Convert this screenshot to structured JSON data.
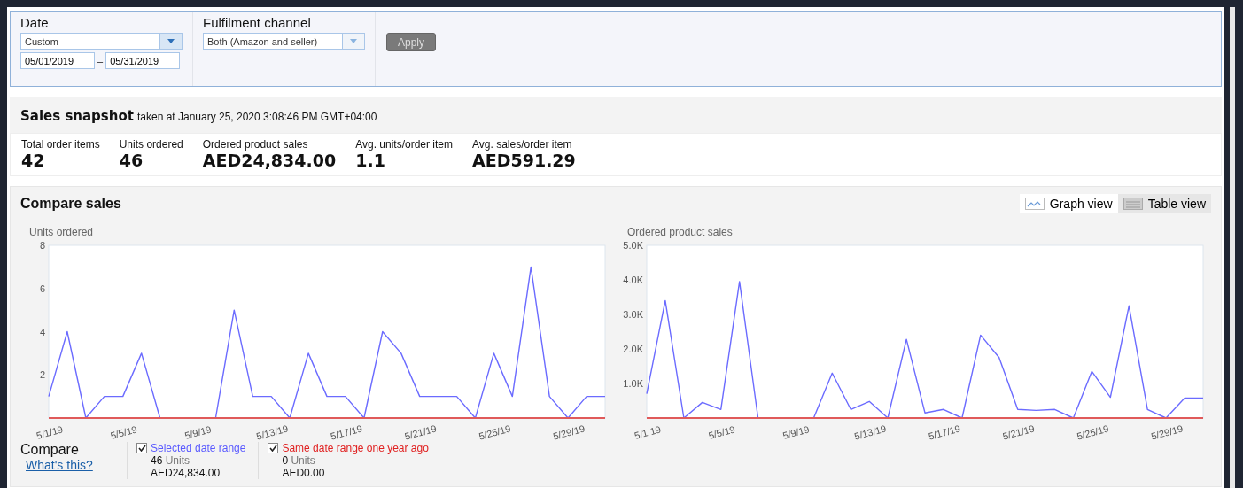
{
  "filters": {
    "date": {
      "label": "Date",
      "preset": "Custom",
      "from": "05/01/2019",
      "separator": "–",
      "to": "05/31/2019"
    },
    "fulfilment": {
      "label": "Fulfilment channel",
      "value": "Both (Amazon and seller)"
    },
    "apply": {
      "label": "Apply",
      "disabled": true
    }
  },
  "snapshot": {
    "title": "Sales snapshot",
    "taken": "taken at January 25, 2020 3:08:46 PM GMT+04:00",
    "metrics": [
      {
        "label": "Total order items",
        "value": "42"
      },
      {
        "label": "Units ordered",
        "value": "46"
      },
      {
        "label": "Ordered product sales",
        "value": "AED24,834.00"
      },
      {
        "label": "Avg. units/order item",
        "value": "1.1"
      },
      {
        "label": "Avg. sales/order item",
        "value": "AED591.29"
      }
    ]
  },
  "compare_sales": {
    "title": "Compare sales",
    "views": [
      {
        "label": "Graph view",
        "kind": "graph",
        "selected": true
      },
      {
        "label": "Table view",
        "kind": "table",
        "selected": false
      }
    ],
    "charts": [
      {
        "chart_data": {
          "type": "line",
          "title": "Units ordered",
          "categories": [
            "5/1/19",
            null,
            null,
            null,
            "5/5/19",
            null,
            null,
            null,
            "5/9/19",
            null,
            null,
            null,
            "5/13/19",
            null,
            null,
            null,
            "5/17/19",
            null,
            null,
            null,
            "5/21/19",
            null,
            null,
            null,
            "5/25/19",
            null,
            null,
            null,
            "5/29/19",
            null,
            null
          ],
          "ylim": [
            0,
            8
          ],
          "yticks": [
            {
              "value": 2,
              "label": "2"
            },
            {
              "value": 4,
              "label": "4"
            },
            {
              "value": 6,
              "label": "6"
            },
            {
              "value": 8,
              "label": "8"
            }
          ],
          "series": [
            {
              "color": "#6b6bff",
              "values": [
                1,
                4,
                0,
                1,
                1,
                3,
                0,
                0,
                0,
                0,
                5,
                1,
                1,
                0,
                3,
                1,
                1,
                0,
                4,
                3,
                1,
                1,
                1,
                0,
                3,
                1,
                7,
                1,
                0,
                1,
                1
              ]
            },
            {
              "color": "#e05a5a",
              "values": [
                0,
                0,
                0,
                0,
                0,
                0,
                0,
                0,
                0,
                0,
                0,
                0,
                0,
                0,
                0,
                0,
                0,
                0,
                0,
                0,
                0,
                0,
                0,
                0,
                0,
                0,
                0,
                0,
                0,
                0,
                0
              ]
            }
          ]
        }
      },
      {
        "chart_data": {
          "type": "line",
          "title": "Ordered product sales",
          "categories": [
            "5/1/19",
            null,
            null,
            null,
            "5/5/19",
            null,
            null,
            null,
            "5/9/19",
            null,
            null,
            null,
            "5/13/19",
            null,
            null,
            null,
            "5/17/19",
            null,
            null,
            null,
            "5/21/19",
            null,
            null,
            null,
            "5/25/19",
            null,
            null,
            null,
            "5/29/19",
            null,
            null
          ],
          "ylim": [
            0,
            5000
          ],
          "yticks": [
            {
              "value": 1000,
              "label": "1.0K"
            },
            {
              "value": 2000,
              "label": "2.0K"
            },
            {
              "value": 3000,
              "label": "3.0K"
            },
            {
              "value": 4000,
              "label": "4.0K"
            },
            {
              "value": 5000,
              "label": "5.0K"
            }
          ],
          "series": [
            {
              "color": "#6b6bff",
              "values": [
                700,
                3400,
                0,
                450,
                250,
                3950,
                0,
                0,
                0,
                0,
                1300,
                250,
                480,
                0,
                2280,
                150,
                250,
                0,
                2400,
                1750,
                250,
                220,
                250,
                0,
                1350,
                600,
                3250,
                250,
                0,
                580,
                580
              ]
            },
            {
              "color": "#e05a5a",
              "values": [
                0,
                0,
                0,
                0,
                0,
                0,
                0,
                0,
                0,
                0,
                0,
                0,
                0,
                0,
                0,
                0,
                0,
                0,
                0,
                0,
                0,
                0,
                0,
                0,
                0,
                0,
                0,
                0,
                0,
                0,
                0
              ]
            }
          ]
        }
      }
    ],
    "compare": {
      "label": "Compare",
      "help_link": "What's this?",
      "items": [
        {
          "label": "Selected date range",
          "checked": true,
          "color": "#5a5aff",
          "count": "46",
          "unit": "Units",
          "amount": "AED24,834.00"
        },
        {
          "label": "Same date range one year ago",
          "checked": true,
          "color": "#e02020",
          "count": "0",
          "unit": "Units",
          "amount": "AED0.00"
        }
      ]
    }
  }
}
